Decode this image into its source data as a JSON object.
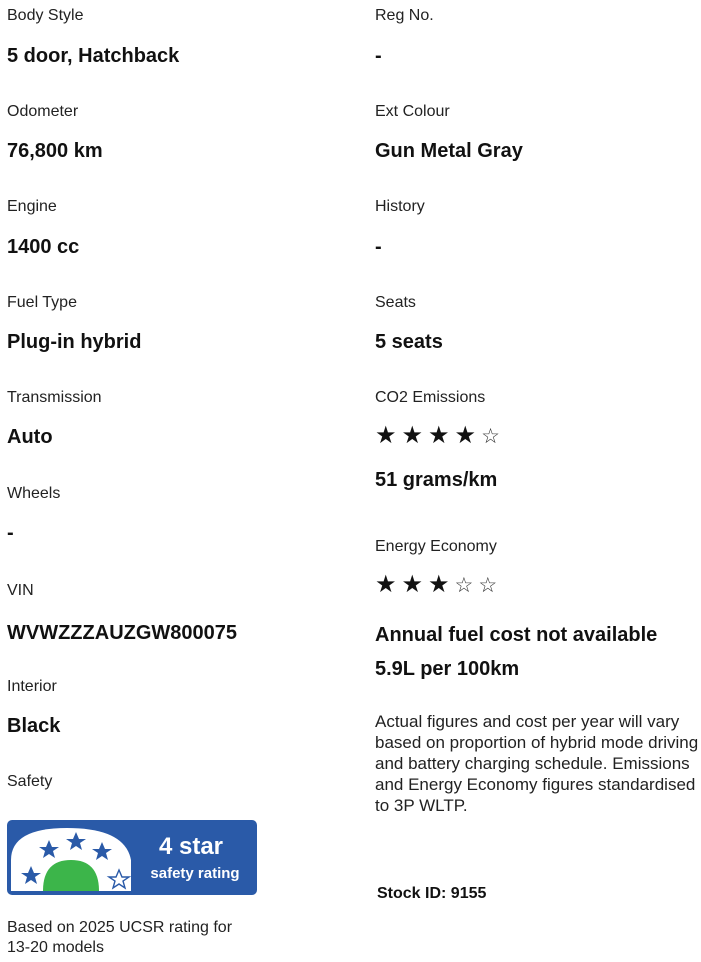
{
  "left": [
    {
      "label": "Body Style",
      "value": "5 door, Hatchback"
    },
    {
      "label": "Odometer",
      "value": "76,800 km"
    },
    {
      "label": "Engine",
      "value": "1400 cc"
    },
    {
      "label": "Fuel Type",
      "value": "Plug-in hybrid"
    },
    {
      "label": "Transmission",
      "value": "Auto"
    },
    {
      "label": "Wheels",
      "value": "-"
    },
    {
      "label": "VIN",
      "value": "WVWZZZAUZGW800075"
    },
    {
      "label": "Interior",
      "value": "Black"
    },
    {
      "label": "Safety"
    }
  ],
  "right": [
    {
      "label": "Reg No.",
      "value": "-"
    },
    {
      "label": "Ext Colour",
      "value": "Gun Metal Gray"
    },
    {
      "label": "History",
      "value": "-"
    },
    {
      "label": "Seats",
      "value": "5 seats"
    }
  ],
  "co2": {
    "label": "CO2 Emissions",
    "rating": 4,
    "max": 5,
    "value": "51 grams/km"
  },
  "energy": {
    "label": "Energy Economy",
    "rating": 3,
    "max": 5,
    "fuel_cost": "Annual fuel cost not available",
    "consumption": "5.9L per 100km"
  },
  "note": "Actual figures and cost per year will vary based on proportion of hybrid mode driving and battery charging schedule. Emissions and Energy Economy figures standardised to 3P WLTP.",
  "stock_id": "Stock ID: 9155",
  "safety_badge": {
    "stars_text": "4 star",
    "rating_text": "safety rating",
    "rating": 4,
    "max": 5,
    "color": "#2a5aa8",
    "star_color": "#2a5aa8",
    "dome_color": "#3cb54a"
  },
  "safety_basis": "Based on 2025 UCSR rating for 13-20 models"
}
